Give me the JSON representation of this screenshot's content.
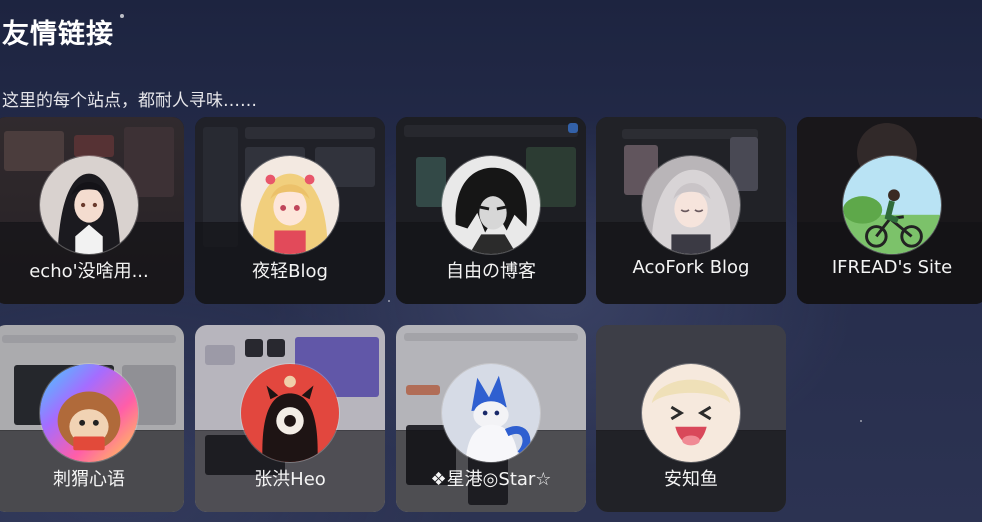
{
  "header": {
    "title": "友情链接",
    "subtitle": "这里的每个站点，都耐人寻味……"
  },
  "links": [
    {
      "name": "echo'没啥用...",
      "avatar": "anime-girl-black-hair-avatar"
    },
    {
      "name": "夜轻Blog",
      "avatar": "anime-girl-blonde-avatar"
    },
    {
      "name": "自由の博客",
      "avatar": "monochrome-anime-boy-avatar"
    },
    {
      "name": "AcoFork Blog",
      "avatar": "anime-girl-silver-hair-avatar"
    },
    {
      "name": "IFREAD's Site",
      "avatar": "cyclist-illustration-avatar"
    },
    {
      "name": "刺猬心语",
      "avatar": "hedgehog-avatar"
    },
    {
      "name": "张洪Heo",
      "avatar": "red-cyclops-creature-avatar"
    },
    {
      "name": "❖星港◎Star☆",
      "avatar": "blue-fox-character-avatar"
    },
    {
      "name": "安知鱼",
      "avatar": "cartoon-laughing-face-avatar"
    }
  ],
  "colors": {
    "background": "#262d4c",
    "card_strip": "#121216",
    "text": "#f4f4f4"
  }
}
